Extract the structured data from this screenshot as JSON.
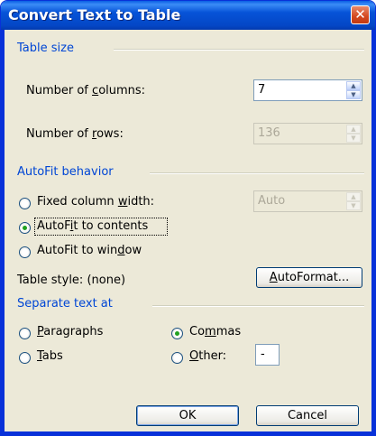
{
  "window": {
    "title": "Convert Text to Table",
    "close_glyph": "✕"
  },
  "table_size": {
    "heading": "Table size",
    "columns_label_pre": "Number of ",
    "columns_label_key": "c",
    "columns_label_post": "olumns:",
    "columns_value": "7",
    "rows_label_pre": "Number of ",
    "rows_label_key": "r",
    "rows_label_post": "ows:",
    "rows_value": "136"
  },
  "autofit": {
    "heading": "AutoFit behavior",
    "fixed_pre": "Fixed column ",
    "fixed_key": "w",
    "fixed_post": "idth:",
    "fixed_value": "Auto",
    "contents_pre": "AutoF",
    "contents_key": "i",
    "contents_post": "t to contents",
    "window_pre": "AutoFit to win",
    "window_key": "d",
    "window_post": "ow",
    "selected": "contents"
  },
  "table_style": {
    "label": "Table style:",
    "value": "(none)",
    "autoformat_key": "A",
    "autoformat_post": "utoFormat..."
  },
  "separate": {
    "heading": "Separate text at",
    "paragraphs_key": "P",
    "paragraphs_post": "aragraphs",
    "tabs_key": "T",
    "tabs_post": "abs",
    "commas_pre": "Co",
    "commas_key": "m",
    "commas_post": "mas",
    "other_key": "O",
    "other_post": "ther:",
    "other_value": "-",
    "selected": "commas"
  },
  "buttons": {
    "ok": "OK",
    "cancel": "Cancel"
  },
  "icons": {
    "spin_up": "▲",
    "spin_down": "▼"
  }
}
